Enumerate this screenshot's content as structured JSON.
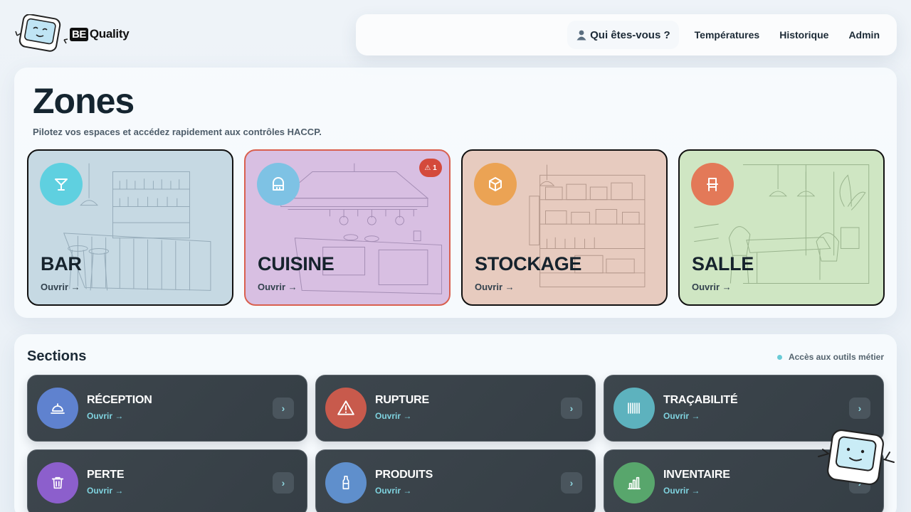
{
  "brand": {
    "prefix": "BE",
    "name": "Quality"
  },
  "nav": {
    "who": "Qui êtes-vous ?",
    "links": [
      "Températures",
      "Historique",
      "Admin"
    ]
  },
  "zones": {
    "title": "Zones",
    "subtitle": "Pilotez vos espaces et accédez rapidement aux contrôles HACCP.",
    "items": [
      {
        "name": "BAR",
        "open": "Ouvrir →",
        "icon": "cocktail-icon",
        "color": "#5fd0e0",
        "bg": "#c6d9e3"
      },
      {
        "name": "CUISINE",
        "open": "Ouvrir →",
        "icon": "oven-icon",
        "color": "#7ec2e4",
        "bg": "#d8bfe2",
        "badge": "⚠ 1"
      },
      {
        "name": "STOCKAGE",
        "open": "Ouvrir →",
        "icon": "box-icon",
        "color": "#eba354",
        "bg": "#e7cbbf"
      },
      {
        "name": "SALLE",
        "open": "Ouvrir →",
        "icon": "chair-icon",
        "color": "#e37958",
        "bg": "#cfe6c3"
      }
    ]
  },
  "sections": {
    "title": "Sections",
    "hint": "Accès aux outils métier",
    "items": [
      {
        "name": "RÉCEPTION",
        "open": "Ouvrir →",
        "icon": "bell-icon",
        "color": "#5f82cf"
      },
      {
        "name": "RUPTURE",
        "open": "Ouvrir →",
        "icon": "warning-icon",
        "color": "#c85a4c"
      },
      {
        "name": "TRAÇABILITÉ",
        "open": "Ouvrir →",
        "icon": "barcode-icon",
        "color": "#5db2be"
      },
      {
        "name": "PERTE",
        "open": "Ouvrir →",
        "icon": "trash-icon",
        "color": "#8c5fcc"
      },
      {
        "name": "PRODUITS",
        "open": "Ouvrir →",
        "icon": "bottle-icon",
        "color": "#5f8fcc"
      },
      {
        "name": "INVENTAIRE",
        "open": "Ouvrir →",
        "icon": "chart-icon",
        "color": "#58a66c"
      }
    ],
    "arrow": "›"
  }
}
